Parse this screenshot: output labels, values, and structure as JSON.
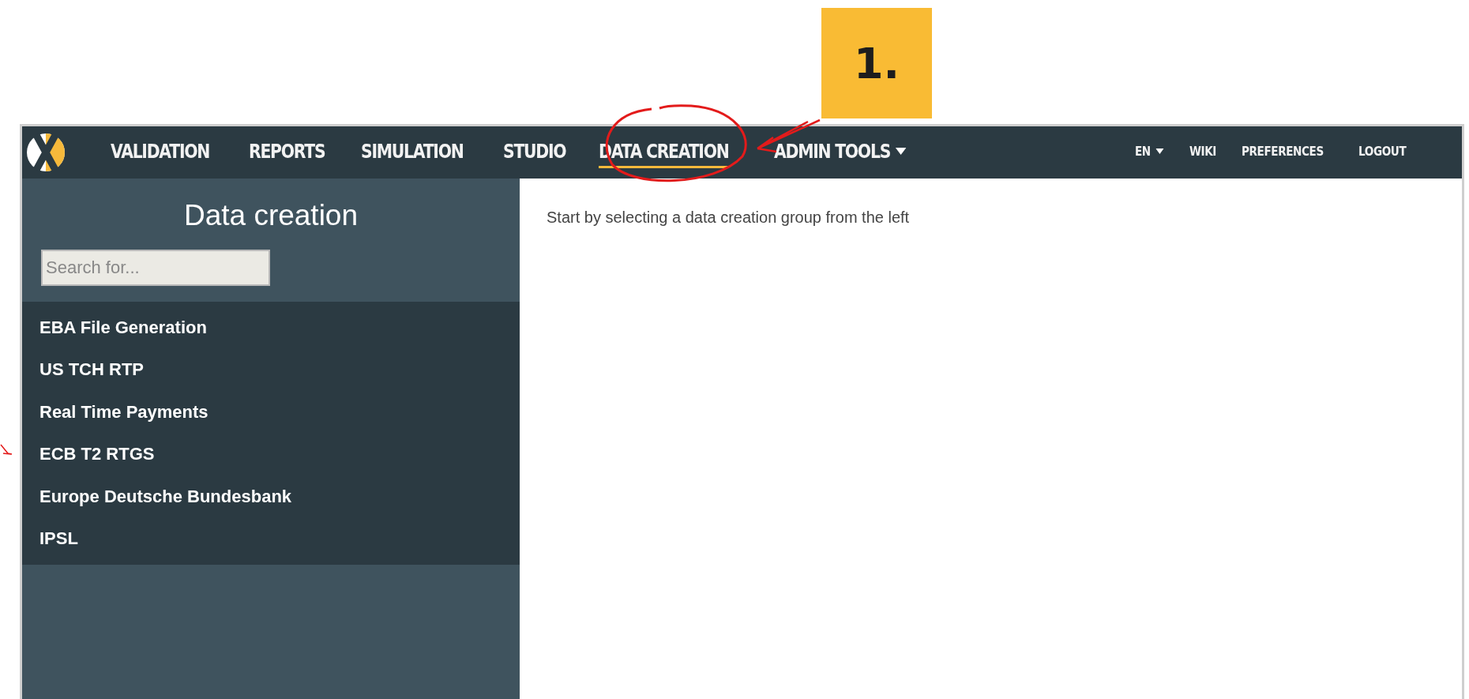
{
  "callout": {
    "label": "1."
  },
  "nav": {
    "items": [
      {
        "label": "VALIDATION",
        "selected": false,
        "dropdown": false
      },
      {
        "label": "REPORTS",
        "selected": false,
        "dropdown": false
      },
      {
        "label": "SIMULATION",
        "selected": false,
        "dropdown": false
      },
      {
        "label": "STUDIO",
        "selected": false,
        "dropdown": false
      },
      {
        "label": "DATA CREATION",
        "selected": true,
        "dropdown": false
      },
      {
        "label": "ADMIN TOOLS",
        "selected": false,
        "dropdown": true
      }
    ],
    "right_items": [
      {
        "label": "EN",
        "dropdown": true
      },
      {
        "label": "WIKI",
        "dropdown": false
      },
      {
        "label": "PREFERENCES",
        "dropdown": false
      },
      {
        "label": "LOGOUT",
        "dropdown": false
      }
    ]
  },
  "sidebar": {
    "title": "Data creation",
    "search": {
      "placeholder": "Search for..."
    },
    "items": [
      {
        "label": "EBA File Generation"
      },
      {
        "label": "US TCH RTP"
      },
      {
        "label": "Real Time Payments"
      },
      {
        "label": "ECB T2 RTGS"
      },
      {
        "label": "Europe Deutsche Bundesbank"
      },
      {
        "label": "IPSL"
      }
    ]
  },
  "main": {
    "message": "Start by selecting a data creation group from the left"
  }
}
